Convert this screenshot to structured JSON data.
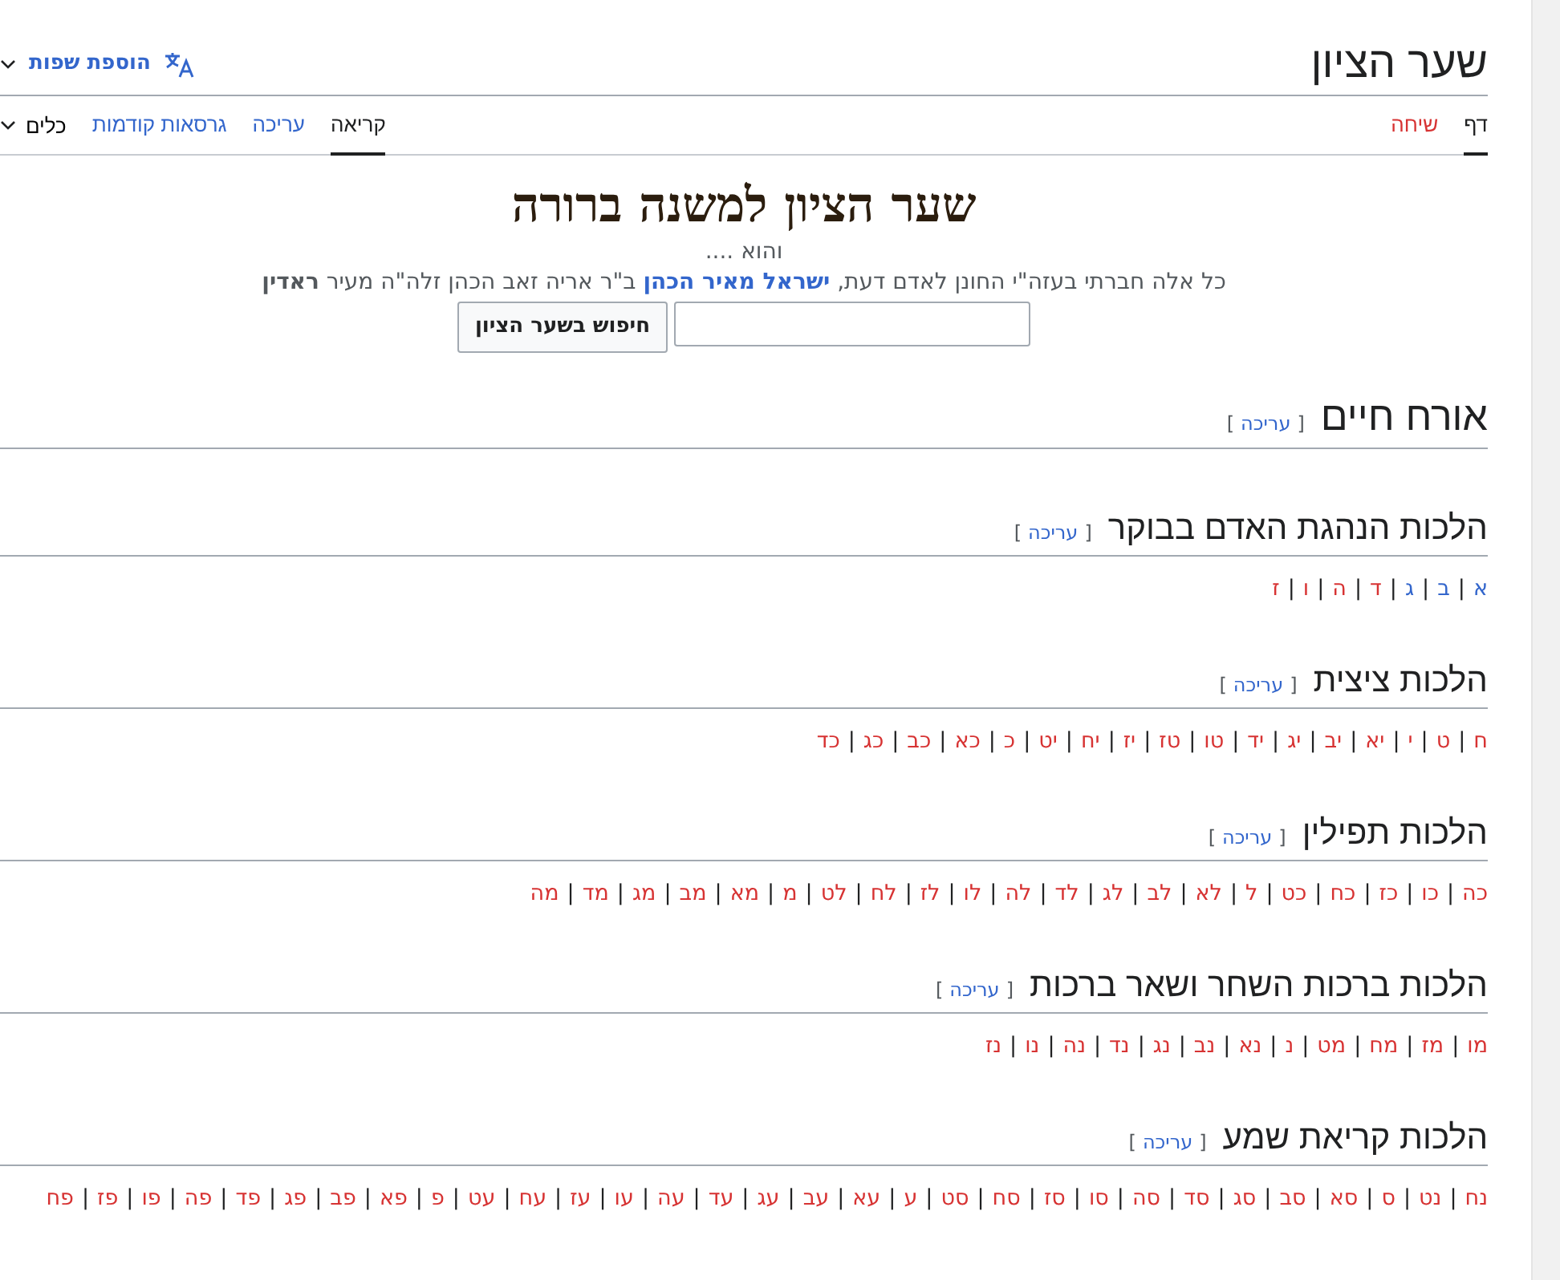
{
  "header": {
    "title": "שער הציון",
    "language_button": "הוספת שפות"
  },
  "page_tabs": [
    {
      "label": "דף",
      "selected": true,
      "exists": true
    },
    {
      "label": "שיחה",
      "selected": false,
      "exists": false
    }
  ],
  "view_tabs": [
    {
      "label": "קריאה",
      "selected": true
    },
    {
      "label": "עריכה",
      "selected": false
    },
    {
      "label": "גרסאות קודמות",
      "selected": false
    }
  ],
  "tools_menu": "כלים",
  "banner": {
    "title": "שער הציון למשנה ברורה",
    "subtitle": "והוא ....",
    "intro_before": "כל אלה חברתי בעזה\"י החונן לאדם דעת,",
    "intro_link": "ישראל מאיר הכהן",
    "intro_after": "ב\"ר אריה זאב הכהן זלה\"ה מעיר **ראדין**",
    "search_button": "חיפוש בשער הציון"
  },
  "sections": [
    {
      "kind": "main",
      "heading": "אורח חיים",
      "edit_open": "[",
      "edit": "עריכה",
      "edit_close": "]"
    },
    {
      "kind": "sub",
      "heading": "הלכות הנהגת האדם בבוקר",
      "edit_open": "[",
      "edit": "עריכה",
      "edit_close": "]",
      "separator": "|",
      "links": [
        {
          "label": "א",
          "exists": true
        },
        {
          "label": "ב",
          "exists": true
        },
        {
          "label": "ג",
          "exists": true
        },
        {
          "label": "ד",
          "exists": false
        },
        {
          "label": "ה",
          "exists": false
        },
        {
          "label": "ו",
          "exists": false
        },
        {
          "label": "ז",
          "exists": false
        }
      ]
    },
    {
      "kind": "sub",
      "heading": "הלכות ציצית",
      "edit_open": "[",
      "edit": "עריכה",
      "edit_close": "]",
      "separator": "|",
      "links": [
        {
          "label": "ח",
          "exists": false
        },
        {
          "label": "ט",
          "exists": false
        },
        {
          "label": "י",
          "exists": false
        },
        {
          "label": "יא",
          "exists": false
        },
        {
          "label": "יב",
          "exists": false
        },
        {
          "label": "יג",
          "exists": false
        },
        {
          "label": "יד",
          "exists": false
        },
        {
          "label": "טו",
          "exists": false
        },
        {
          "label": "טז",
          "exists": false
        },
        {
          "label": "יז",
          "exists": false
        },
        {
          "label": "יח",
          "exists": false
        },
        {
          "label": "יט",
          "exists": false
        },
        {
          "label": "כ",
          "exists": false
        },
        {
          "label": "כא",
          "exists": false
        },
        {
          "label": "כב",
          "exists": false
        },
        {
          "label": "כג",
          "exists": false
        },
        {
          "label": "כד",
          "exists": false
        }
      ]
    },
    {
      "kind": "sub",
      "heading": "הלכות תפילין",
      "edit_open": "[",
      "edit": "עריכה",
      "edit_close": "]",
      "separator": "|",
      "links": [
        {
          "label": "כה",
          "exists": false
        },
        {
          "label": "כו",
          "exists": false
        },
        {
          "label": "כז",
          "exists": false
        },
        {
          "label": "כח",
          "exists": false
        },
        {
          "label": "כט",
          "exists": false
        },
        {
          "label": "ל",
          "exists": false
        },
        {
          "label": "לא",
          "exists": false
        },
        {
          "label": "לב",
          "exists": false
        },
        {
          "label": "לג",
          "exists": false
        },
        {
          "label": "לד",
          "exists": false
        },
        {
          "label": "לה",
          "exists": false
        },
        {
          "label": "לו",
          "exists": false
        },
        {
          "label": "לז",
          "exists": false
        },
        {
          "label": "לח",
          "exists": false
        },
        {
          "label": "לט",
          "exists": false
        },
        {
          "label": "מ",
          "exists": false
        },
        {
          "label": "מא",
          "exists": false
        },
        {
          "label": "מב",
          "exists": false
        },
        {
          "label": "מג",
          "exists": false
        },
        {
          "label": "מד",
          "exists": false
        },
        {
          "label": "מה",
          "exists": false
        }
      ]
    },
    {
      "kind": "sub",
      "heading": "הלכות ברכות השחר ושאר ברכות",
      "edit_open": "[",
      "edit": "עריכה",
      "edit_close": "]",
      "separator": "|",
      "links": [
        {
          "label": "מו",
          "exists": false
        },
        {
          "label": "מז",
          "exists": false
        },
        {
          "label": "מח",
          "exists": false
        },
        {
          "label": "מט",
          "exists": false
        },
        {
          "label": "נ",
          "exists": false
        },
        {
          "label": "נא",
          "exists": false
        },
        {
          "label": "נב",
          "exists": false
        },
        {
          "label": "נג",
          "exists": false
        },
        {
          "label": "נד",
          "exists": false
        },
        {
          "label": "נה",
          "exists": false
        },
        {
          "label": "נו",
          "exists": false
        },
        {
          "label": "נז",
          "exists": false
        }
      ]
    },
    {
      "kind": "sub",
      "heading": "הלכות קריאת שמע",
      "edit_open": "[",
      "edit": "עריכה",
      "edit_close": "]",
      "separator": "|",
      "links": [
        {
          "label": "נח",
          "exists": false
        },
        {
          "label": "נט",
          "exists": false
        },
        {
          "label": "ס",
          "exists": false
        },
        {
          "label": "סא",
          "exists": false
        },
        {
          "label": "סב",
          "exists": false
        },
        {
          "label": "סג",
          "exists": false
        },
        {
          "label": "סד",
          "exists": false
        },
        {
          "label": "סה",
          "exists": false
        },
        {
          "label": "סו",
          "exists": false
        },
        {
          "label": "סז",
          "exists": false
        },
        {
          "label": "סח",
          "exists": false
        },
        {
          "label": "סט",
          "exists": false
        },
        {
          "label": "ע",
          "exists": false
        },
        {
          "label": "עא",
          "exists": false
        },
        {
          "label": "עב",
          "exists": false
        },
        {
          "label": "עג",
          "exists": false
        },
        {
          "label": "עד",
          "exists": false
        },
        {
          "label": "עה",
          "exists": false
        },
        {
          "label": "עו",
          "exists": false
        },
        {
          "label": "עז",
          "exists": false
        },
        {
          "label": "עח",
          "exists": false
        },
        {
          "label": "עט",
          "exists": false
        },
        {
          "label": "פ",
          "exists": false
        },
        {
          "label": "פא",
          "exists": false
        },
        {
          "label": "פב",
          "exists": false
        },
        {
          "label": "פג",
          "exists": false
        },
        {
          "label": "פד",
          "exists": false
        },
        {
          "label": "פה",
          "exists": false
        },
        {
          "label": "פו",
          "exists": false
        },
        {
          "label": "פז",
          "exists": false
        },
        {
          "label": "פח",
          "exists": false
        }
      ]
    }
  ]
}
